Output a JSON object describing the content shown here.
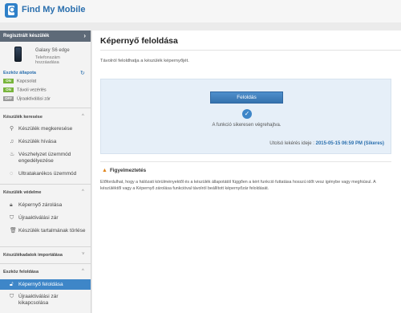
{
  "header": {
    "app_title": "Find My Mobile"
  },
  "sidebar": {
    "registered_label": "Regisztrált készülék",
    "device": {
      "name": "Galaxy S6 edge",
      "status": "Telefonszám hozzáadása"
    },
    "device_status": {
      "title": "Eszköz állapota",
      "rows": [
        {
          "badge": "ON",
          "label": "Kapcsolat"
        },
        {
          "badge": "ON",
          "label": "Távoli vezérlés"
        },
        {
          "badge": "OFF",
          "label": "Újraaktiválási zár"
        }
      ]
    },
    "sections": {
      "search": "Készülék keresése",
      "protection": "Készülék védelme",
      "import": "Készülékadatok importálása",
      "unlock": "Eszköz feloldása"
    },
    "items": {
      "find": "Készülék megkeresése",
      "ring": "Készülék hívása",
      "emergency": "Vészhelyzet üzemmód engedélyezése",
      "ultra": "Ultratakarékos üzemmód",
      "lock": "Képernyő zárolása",
      "reactivation": "Újraaktiválási zár",
      "wipe": "Készülék tartalmának törlése",
      "unlock_screen": "Képernyő feloldása",
      "reactivation_off": "Újraaktiválási zár kikapcsolása"
    }
  },
  "main": {
    "title": "Képernyő feloldása",
    "description": "Távolról feloldhatja a készülék képernyőjét.",
    "unlock_button": "Feloldás",
    "success_message": "A funkció sikeresen végrehajtva.",
    "last_request_label": "Utolsó lekérés ideje :",
    "last_request_value": "2015-05-15 06:59 PM (Sikeres)",
    "warning_title": "Figyelmeztetés",
    "warning_text": "Előfordulhat, hogy a hálózati körülményektől és a készülék állapotától függően a kért funkció futtatása hosszú időt vesz igénybe vagy meghiúsul. A készüléktől vagy a Képernyő zárolása funkcióval távolról beállított képernyőzár feloldását."
  },
  "colors": {
    "accent": "#3e86c8",
    "header_bar": "#5e6a78",
    "status_on": "#78b43c",
    "status_off": "#9a9a9a",
    "warning": "#e0861e"
  }
}
